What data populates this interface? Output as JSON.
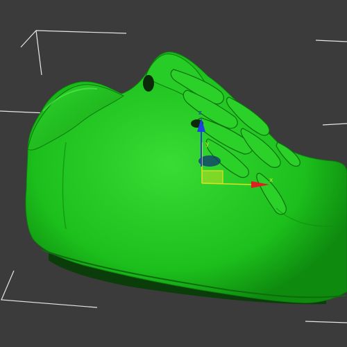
{
  "viewport": {
    "background": "#3b3b3b",
    "selection_bracket_color": "#e6e6e6"
  },
  "model": {
    "name": "shoe-mesh",
    "color": "#1fbf1f",
    "color_light": "#3ee03a",
    "color_dark": "#0f7f0f"
  },
  "gizmo": {
    "x_label": "x",
    "y_label": "y",
    "z_label": "z",
    "x_color": "#e02020",
    "y_color": "#e0e020",
    "z_color": "#2040e0",
    "plane_color": "#e0e020"
  }
}
